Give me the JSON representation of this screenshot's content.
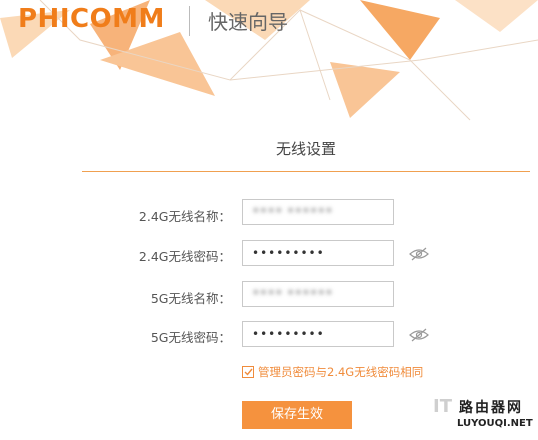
{
  "header": {
    "logo_text": "PHICOMM",
    "wizard_title": "快速向导"
  },
  "section": {
    "title": "无线设置"
  },
  "form": {
    "ssid_24g": {
      "label": "2.4G无线名称：",
      "value": "•••• ••••••"
    },
    "pwd_24g": {
      "label": "2.4G无线密码：",
      "value": "•••••••••"
    },
    "ssid_5g": {
      "label": "5G无线名称：",
      "value": "•••• ••••••"
    },
    "pwd_5g": {
      "label": "5G无线密码：",
      "value": "•••••••••"
    },
    "same_password": {
      "label": "管理员密码与2.4G无线密码相同",
      "checked": true
    },
    "save_label": "保存生效"
  },
  "watermark": {
    "it": "IT",
    "site_name": "路由器网",
    "url": "LUYOUQI.NET"
  },
  "colors": {
    "brand": "#f07d1a",
    "button": "#f5923e",
    "accent_light": "#f9c596"
  },
  "icons": {
    "password_toggle": "eye-slash-icon",
    "checkbox": "check-icon"
  }
}
